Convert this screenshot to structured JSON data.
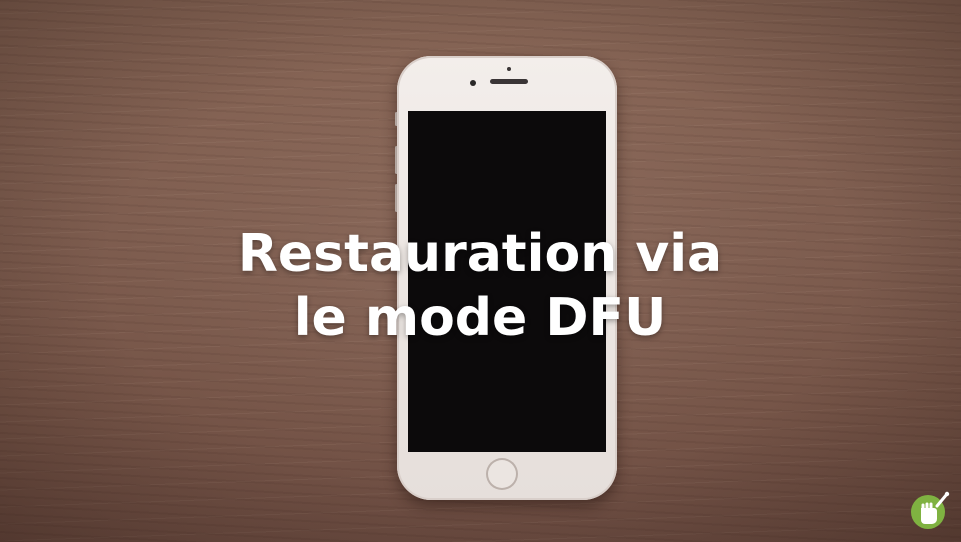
{
  "title": {
    "line1": "Restauration via",
    "line2": "le mode DFU"
  },
  "device": {
    "type": "smartphone",
    "color": "#f3eeeb",
    "screen_color": "#0c0a0b"
  },
  "logo": {
    "icon": "fist-logo-icon",
    "color": "#7fb241"
  },
  "background": {
    "texture": "wood",
    "color": "#7f5e50"
  }
}
